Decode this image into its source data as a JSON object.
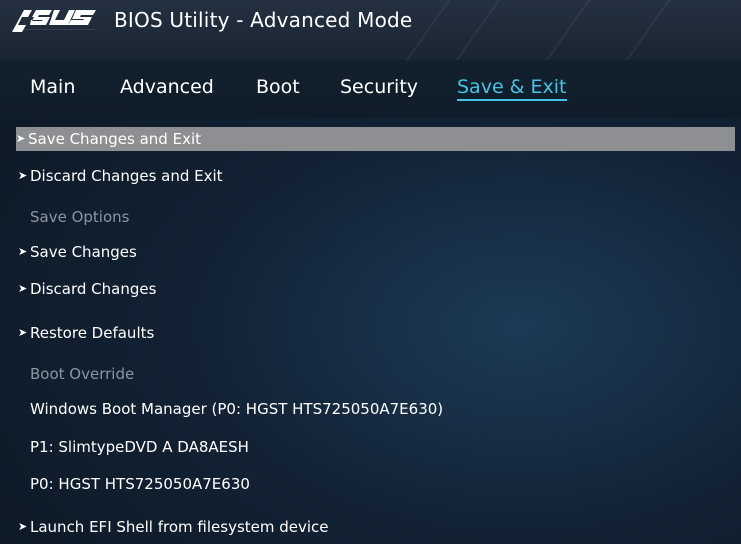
{
  "header": {
    "logo_text": "ASUS",
    "title": "BIOS Utility - Advanced Mode"
  },
  "tabs": [
    {
      "label": "Main"
    },
    {
      "label": "Advanced"
    },
    {
      "label": "Boot"
    },
    {
      "label": "Security"
    },
    {
      "label": "Save & Exit",
      "active": true
    }
  ],
  "menu": {
    "save_changes_exit": "Save Changes and Exit",
    "discard_changes_exit": "Discard Changes and Exit",
    "save_options_header": "Save Options",
    "save_changes": "Save Changes",
    "discard_changes": "Discard Changes",
    "restore_defaults": "Restore Defaults",
    "boot_override_header": "Boot Override",
    "boot_option_1": "Windows Boot Manager (P0: HGST HTS725050A7E630)",
    "boot_option_2": "P1: SlimtypeDVD A  DA8AESH",
    "boot_option_3": "P0: HGST HTS725050A7E630",
    "launch_efi_shell": "Launch EFI Shell from filesystem device"
  },
  "colors": {
    "accent": "#46c3e6",
    "selected_row": "#8d8f92",
    "section_header": "#8a96a3"
  }
}
